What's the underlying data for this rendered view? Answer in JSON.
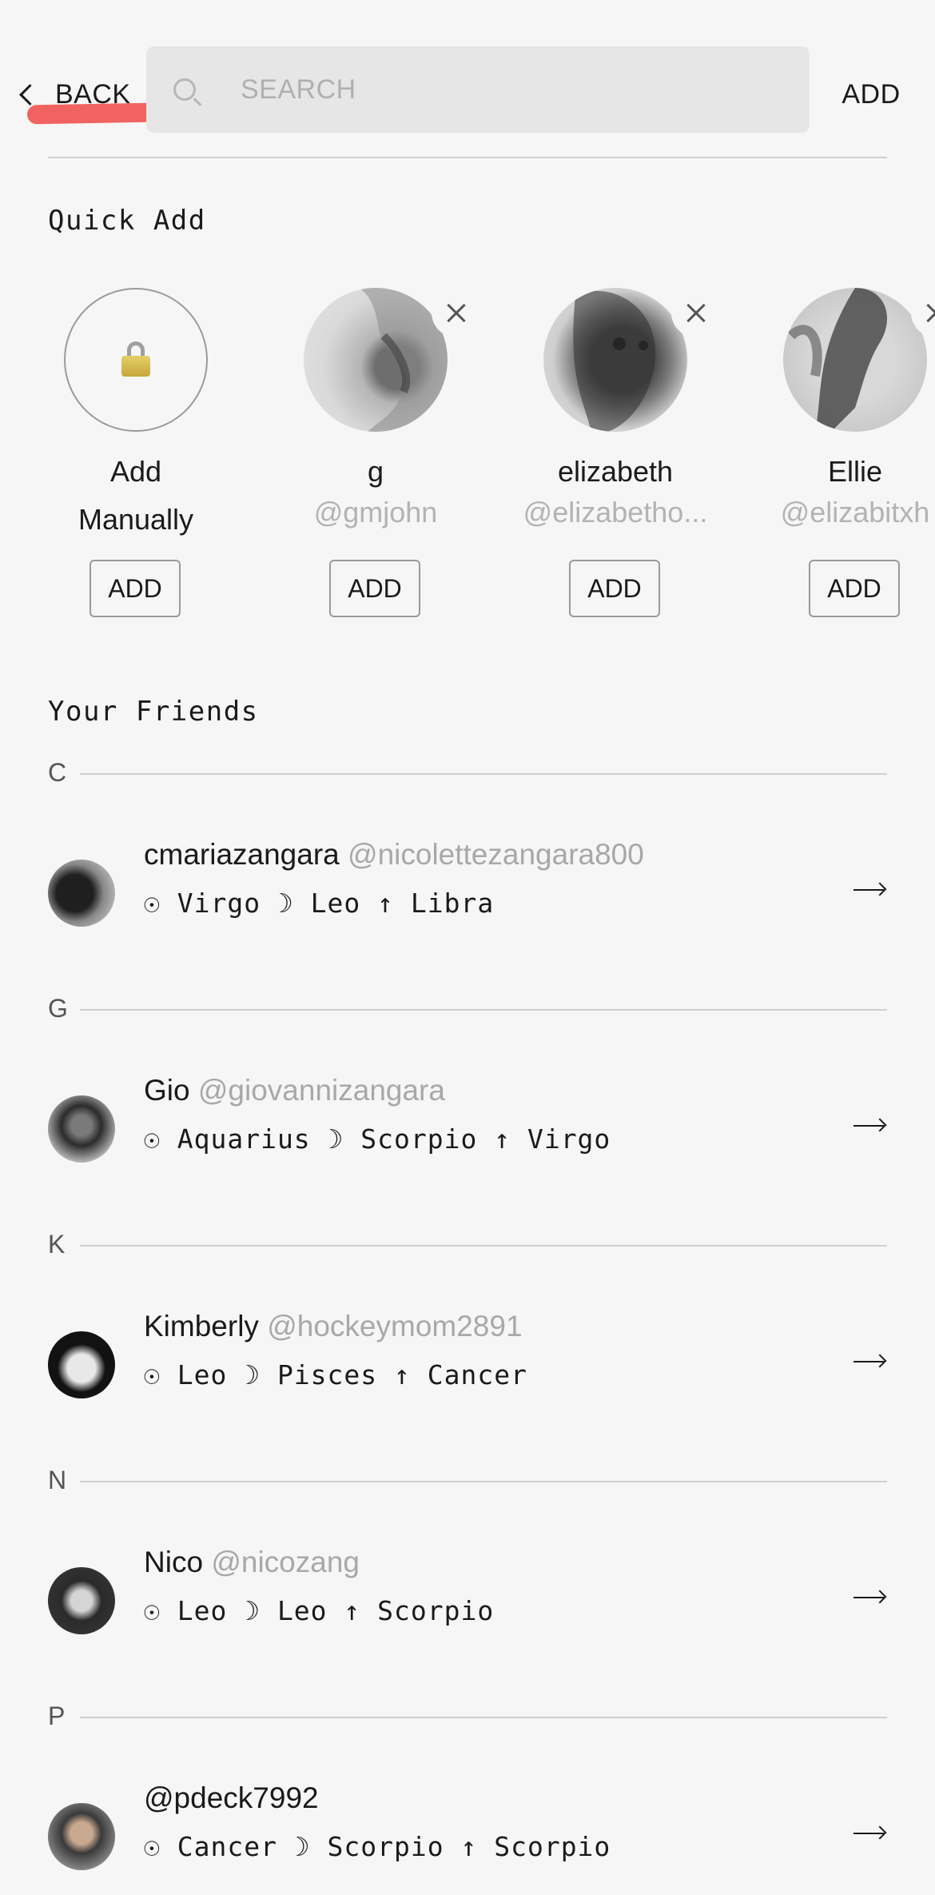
{
  "header": {
    "back_label": "BACK",
    "search_placeholder": "SEARCH",
    "add_label": "ADD"
  },
  "quick_add": {
    "title": "Quick Add",
    "manual": {
      "label_line1": "Add",
      "label_line2": "Manually",
      "button": "ADD",
      "icon": "lock-icon"
    },
    "suggestions": [
      {
        "name": "g",
        "handle": "@gmjohn",
        "button": "ADD"
      },
      {
        "name": "elizabeth",
        "handle": "@elizabetho...",
        "button": "ADD"
      },
      {
        "name": "Ellie",
        "handle": "@elizabitxh",
        "button": "ADD"
      }
    ]
  },
  "friends": {
    "title": "Your Friends",
    "groups": [
      {
        "letter": "C",
        "items": [
          {
            "name": "cmariazangara",
            "handle": "@nicolettezangara800",
            "signs": "☉ Virgo ☽ Leo ↑ Libra"
          }
        ]
      },
      {
        "letter": "G",
        "items": [
          {
            "name": "Gio",
            "handle": "@giovannizangara",
            "signs": "☉ Aquarius ☽ Scorpio ↑ Virgo"
          }
        ]
      },
      {
        "letter": "K",
        "items": [
          {
            "name": "Kimberly",
            "handle": "@hockeymom2891",
            "signs": "☉ Leo ☽ Pisces ↑ Cancer"
          }
        ]
      },
      {
        "letter": "N",
        "items": [
          {
            "name": "Nico",
            "handle": "@nicozang",
            "signs": "☉ Leo ☽ Leo ↑ Scorpio"
          }
        ]
      },
      {
        "letter": "P",
        "items": [
          {
            "name": "",
            "handle": "@pdeck7992",
            "signs": "☉ Cancer ☽ Scorpio ↑ Scorpio"
          }
        ]
      }
    ]
  },
  "colors": {
    "background": "#f6f6f6",
    "accent_underline": "#ef5350",
    "muted_text": "#a8a8a8"
  }
}
